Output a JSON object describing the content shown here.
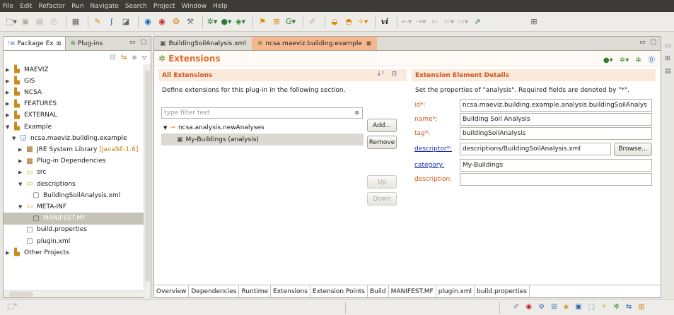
{
  "menu": [
    "File",
    "Edit",
    "Refactor",
    "Run",
    "Navigate",
    "Search",
    "Project",
    "Window",
    "Help"
  ],
  "toolbar": {
    "icons": [
      "new-icon",
      "save-icon",
      "save-all-icon",
      "print-icon",
      "sep",
      "open-type-icon",
      "sep",
      "debug-icon",
      "run-icon",
      "sep",
      "build-icon",
      "refresh-icon",
      "gear-icon",
      "sep",
      "globe-icon",
      "record-icon",
      "bug-icon",
      "tools-icon",
      "sep",
      "run-dropdown-icon",
      "external-tool-icon",
      "sep",
      "pin-icon",
      "grid-icon",
      "settings-icon",
      "sep",
      "pencil-icon",
      "sep",
      "folder-icon",
      "folder-open-icon",
      "wand-icon",
      "sep",
      "vi-icon",
      "sep",
      "back-icon",
      "forward-icon",
      "prev-edit-icon",
      "nav-back-icon",
      "nav-forward-icon",
      "sep",
      "share-icon",
      "perspective-icon"
    ]
  },
  "left_panel": {
    "tabs": [
      {
        "label": "Package Ex",
        "active": true
      },
      {
        "label": "Plug-ins",
        "active": false
      }
    ],
    "tree": [
      {
        "label": "MAEVIZ",
        "icon": "pkgfolder",
        "twisty": "▶",
        "indent": 0
      },
      {
        "label": "GIS",
        "icon": "pkgfolder",
        "twisty": "▶",
        "indent": 0
      },
      {
        "label": "NCSA",
        "icon": "pkgfolder",
        "twisty": "▶",
        "indent": 0
      },
      {
        "label": "FEATURES",
        "icon": "pkgfolder",
        "twisty": "▶",
        "indent": 0
      },
      {
        "label": "EXTERNAL",
        "icon": "pkgfolder",
        "twisty": "▶",
        "indent": 0
      },
      {
        "label": "Example",
        "icon": "pkgfolder",
        "twisty": "▼",
        "indent": 0
      },
      {
        "label": "ncsa.maeviz.building.example",
        "icon": "proj",
        "twisty": "▼",
        "indent": 1
      },
      {
        "label": "JRE System Library",
        "aux": "[JavaSE-1.6]",
        "icon": "lib",
        "twisty": "▶",
        "indent": 2
      },
      {
        "label": "Plug-in Dependencies",
        "icon": "lib",
        "twisty": "▶",
        "indent": 2
      },
      {
        "label": "src",
        "icon": "folder",
        "twisty": "▶",
        "indent": 2
      },
      {
        "label": "descriptions",
        "icon": "folder",
        "twisty": "▼",
        "indent": 2
      },
      {
        "label": "BuildingSoilAnalysis.xml",
        "icon": "file",
        "twisty": "",
        "indent": 3
      },
      {
        "label": "META-INF",
        "icon": "folder",
        "twisty": "▼",
        "indent": 2
      },
      {
        "label": "MANIFEST.MF",
        "icon": "file",
        "twisty": "",
        "indent": 3,
        "selected": true
      },
      {
        "label": "build.properties",
        "icon": "file",
        "twisty": "",
        "indent": 2
      },
      {
        "label": "plugin.xml",
        "icon": "file",
        "twisty": "",
        "indent": 2
      },
      {
        "label": "Other Projects",
        "icon": "pkgfolder",
        "twisty": "▶",
        "indent": 0
      }
    ]
  },
  "editor": {
    "tabs": [
      {
        "label": "BuildingSoilAnalysis.xml",
        "active": false
      },
      {
        "label": "ncsa.maeviz.building.example",
        "active": true
      }
    ],
    "form_title": "Extensions",
    "all_extensions": {
      "title": "All Extensions",
      "description": "Define extensions for this plug-in in the following section.",
      "filter_placeholder": "type filter text",
      "items": [
        {
          "label": "ncsa.analysis.newAnalyses",
          "level": 0,
          "selected": false
        },
        {
          "label": "My-Buildings (analysis)",
          "level": 1,
          "selected": true
        }
      ],
      "buttons": {
        "add": "Add...",
        "remove": "Remove",
        "up": "Up",
        "down": "Down"
      }
    },
    "details": {
      "title": "Extension Element Details",
      "description": "Set the properties of \"analysis\". Required fields are denoted by \"*\".",
      "fields": [
        {
          "label": "id*:",
          "value": "ncsa.maeviz.building.example.analysis.buildingSoilAnalys",
          "link": false
        },
        {
          "label": "name*:",
          "value": "Building Soil Analysis",
          "link": false
        },
        {
          "label": "tag*:",
          "value": "buildingSoilAnalysis",
          "link": false
        },
        {
          "label": "descriptor*:",
          "value": "descriptions/BuildingSoilAnalysis.xml",
          "link": true,
          "browse": "Browse..."
        },
        {
          "label": "category:",
          "value": "My-Buildings",
          "link": true
        },
        {
          "label": "description:",
          "value": "",
          "link": false
        }
      ]
    },
    "bottom_tabs": [
      "Overview",
      "Dependencies",
      "Runtime",
      "Extensions",
      "Extension Points",
      "Build",
      "MANIFEST.MF",
      "plugin.xml",
      "build.properties"
    ],
    "active_bottom_tab": "Extensions"
  }
}
